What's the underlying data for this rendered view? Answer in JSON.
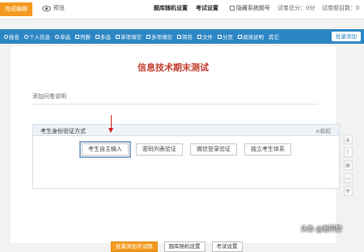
{
  "topbar": {
    "finish": "完成编辑",
    "preview": "预览",
    "nav": [
      "题库随机设置",
      "考试设置"
    ],
    "hide_code": "隐藏系统题号",
    "total_score": "试卷总分：0分",
    "question_count": "试卷题目数：0"
  },
  "toolbar": {
    "items": [
      {
        "label": "姓名",
        "icon": "person-icon"
      },
      {
        "label": "个人信息",
        "icon": "person-icon"
      },
      {
        "label": "单选",
        "icon": "radio-icon"
      },
      {
        "label": "判断",
        "icon": "judge-icon"
      },
      {
        "label": "多选",
        "icon": "checkbox-icon"
      },
      {
        "label": "单项填空",
        "icon": "blank-icon"
      },
      {
        "label": "多项填空",
        "icon": "blank-icon"
      },
      {
        "label": "简答",
        "icon": "text-icon"
      },
      {
        "label": "文件",
        "icon": "file-icon"
      },
      {
        "label": "分页",
        "icon": "page-icon"
      },
      {
        "label": "阅读说明",
        "icon": "text-icon"
      },
      {
        "label": "其它",
        "icon": "more-icon"
      }
    ],
    "batch_add": "批量添加"
  },
  "doc": {
    "title": "信息技术期末测试",
    "description": "添加问卷说明"
  },
  "panel": {
    "title": "考生身份验证方式",
    "collapse": "∧收起",
    "options": [
      "考生自主输入",
      "密码列表验证",
      "微信登录验证",
      "独立考生体系"
    ]
  },
  "bottom": {
    "buttons": [
      "批量添加考试题",
      "题库随机设置",
      "考试设置"
    ]
  },
  "side": [
    "▲",
    "?",
    "●",
    "▭",
    "▼"
  ],
  "watermark": "头条 @谢阿黎",
  "colors": {
    "accent": "#2d86c4",
    "orange": "#f39a1e",
    "title_red": "#c0392b",
    "arrow": "#d21a1a"
  }
}
